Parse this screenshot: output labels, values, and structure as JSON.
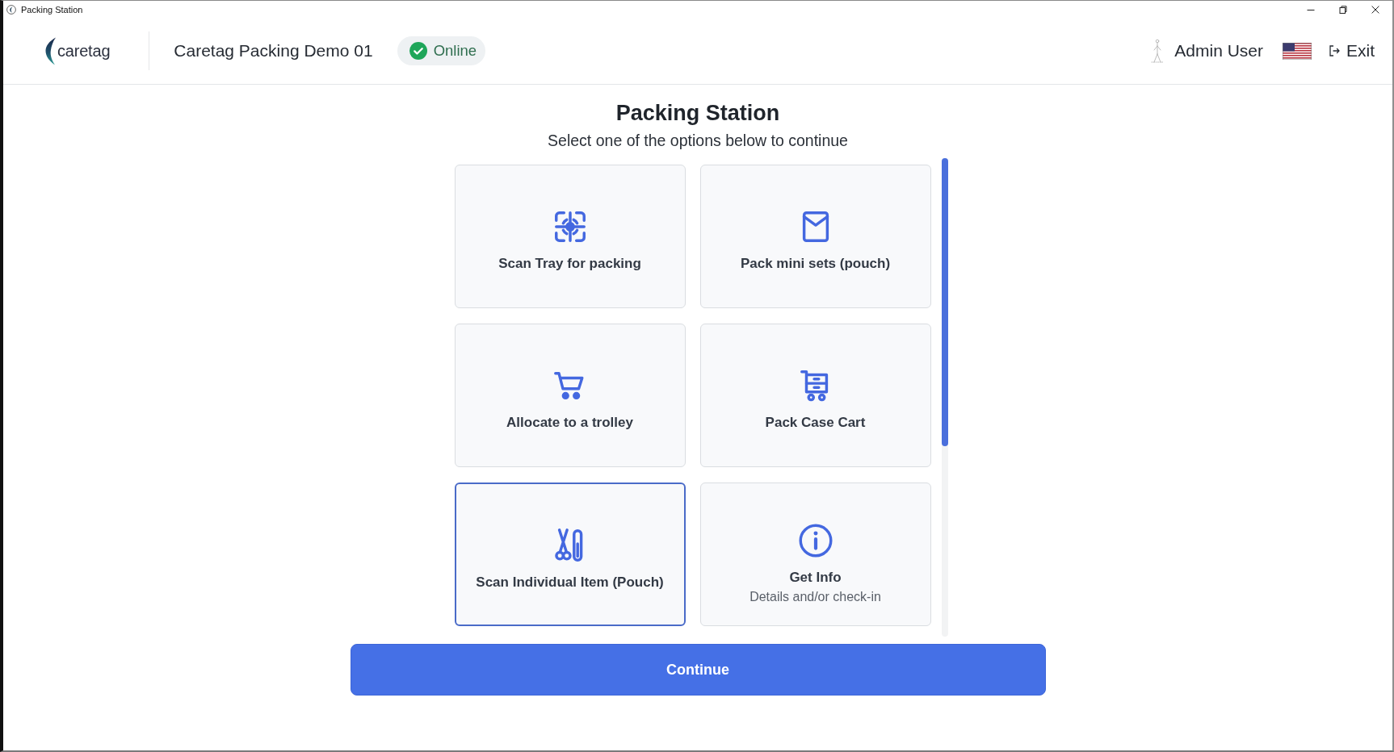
{
  "window": {
    "title": "Packing Station"
  },
  "header": {
    "logo_text": "caretag",
    "station_name": "Caretag Packing Demo 01",
    "status": {
      "label": "Online",
      "online": true
    },
    "user_name": "Admin User",
    "exit_label": "Exit"
  },
  "main": {
    "title": "Packing Station",
    "subtitle": "Select one of the options below to continue",
    "options": [
      {
        "kind": "scan",
        "label": "Scan Tray for packing",
        "selected": false
      },
      {
        "kind": "pouch",
        "label": "Pack mini sets (pouch)",
        "selected": false
      },
      {
        "kind": "trolley",
        "label": "Allocate to a trolley",
        "selected": false
      },
      {
        "kind": "casecart",
        "label": "Pack Case Cart",
        "selected": false
      },
      {
        "kind": "instruments",
        "label": "Scan Individual Item (Pouch)",
        "selected": true
      },
      {
        "kind": "info",
        "label": "Get Info",
        "description": "Details and/or check-in",
        "selected": false
      }
    ],
    "continue_label": "Continue"
  }
}
